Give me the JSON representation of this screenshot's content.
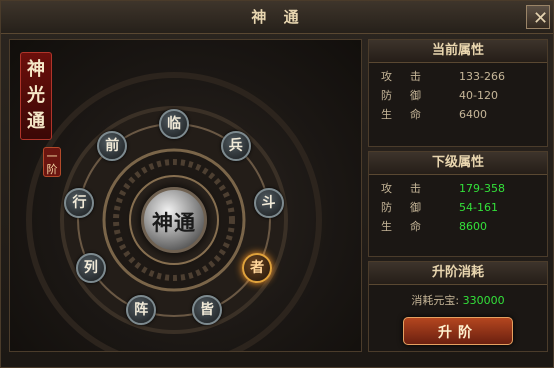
{
  "window": {
    "title": "神 通",
    "close_icon": "✕"
  },
  "left_panel": {
    "banner_text": "神光通",
    "tier_badge": "一阶",
    "center_label": "神通",
    "nodes": [
      {
        "label": "临",
        "active": false
      },
      {
        "label": "兵",
        "active": false
      },
      {
        "label": "斗",
        "active": false
      },
      {
        "label": "者",
        "active": true
      },
      {
        "label": "皆",
        "active": false
      },
      {
        "label": "阵",
        "active": false
      },
      {
        "label": "列",
        "active": false
      },
      {
        "label": "行",
        "active": false
      },
      {
        "label": "前",
        "active": false
      }
    ]
  },
  "current_attrs": {
    "header": "当前属性",
    "rows": [
      {
        "key": "攻击",
        "value": "133-266"
      },
      {
        "key": "防御",
        "value": "40-120"
      },
      {
        "key": "生命",
        "value": "6400"
      }
    ]
  },
  "next_attrs": {
    "header": "下级属性",
    "rows": [
      {
        "key": "攻击",
        "value": "179-358"
      },
      {
        "key": "防御",
        "value": "54-161"
      },
      {
        "key": "生命",
        "value": "8600"
      }
    ]
  },
  "upgrade": {
    "header": "升阶消耗",
    "cost_label": "消耗元宝:",
    "cost_value": "330000",
    "button_label": "升阶"
  },
  "colors": {
    "accent_green": "#33e03a",
    "gold": "#e0a23c",
    "frame": "#4b3c2b"
  }
}
